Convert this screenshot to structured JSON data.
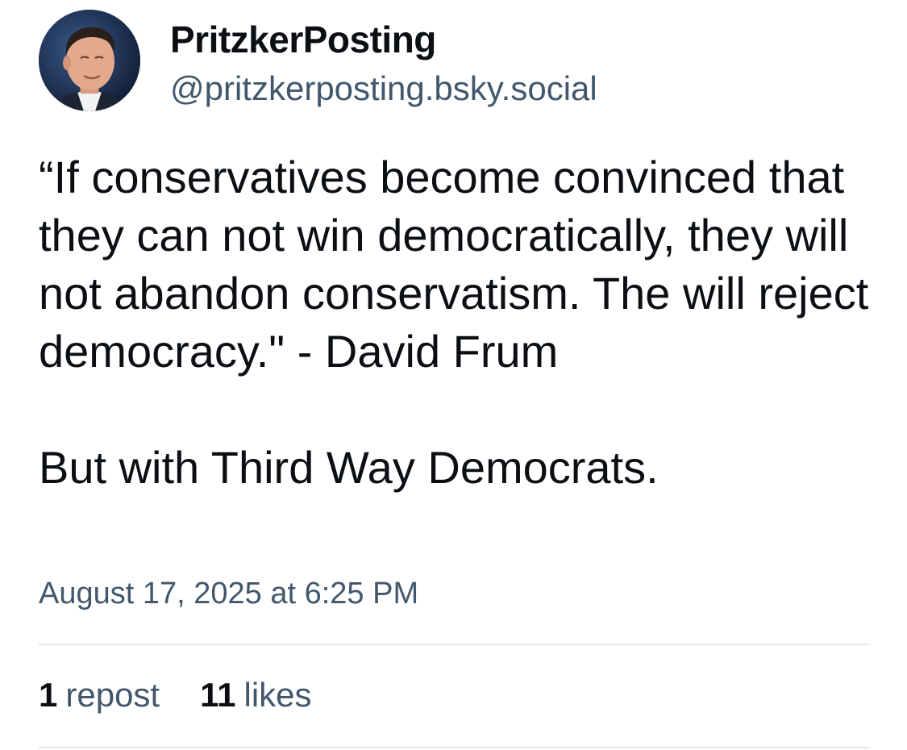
{
  "author": {
    "display_name": "PritzkerPosting",
    "handle": "@pritzkerposting.bsky.social",
    "avatar_icon": "profile-photo"
  },
  "post": {
    "paragraphs": [
      "“If conservatives become convinced that they can not win democratically, they will not abandon conservatism. The will reject democracy.\" - David Frum",
      "But with Third Way Democrats."
    ],
    "timestamp": "August 17, 2025 at 6:25 PM"
  },
  "stats": {
    "reposts_count": "1",
    "reposts_label": "repost",
    "likes_count": "11",
    "likes_label": "likes"
  },
  "colors": {
    "text": "#0b0f14",
    "secondary": "#42576c",
    "divider": "#e4e8ec"
  }
}
